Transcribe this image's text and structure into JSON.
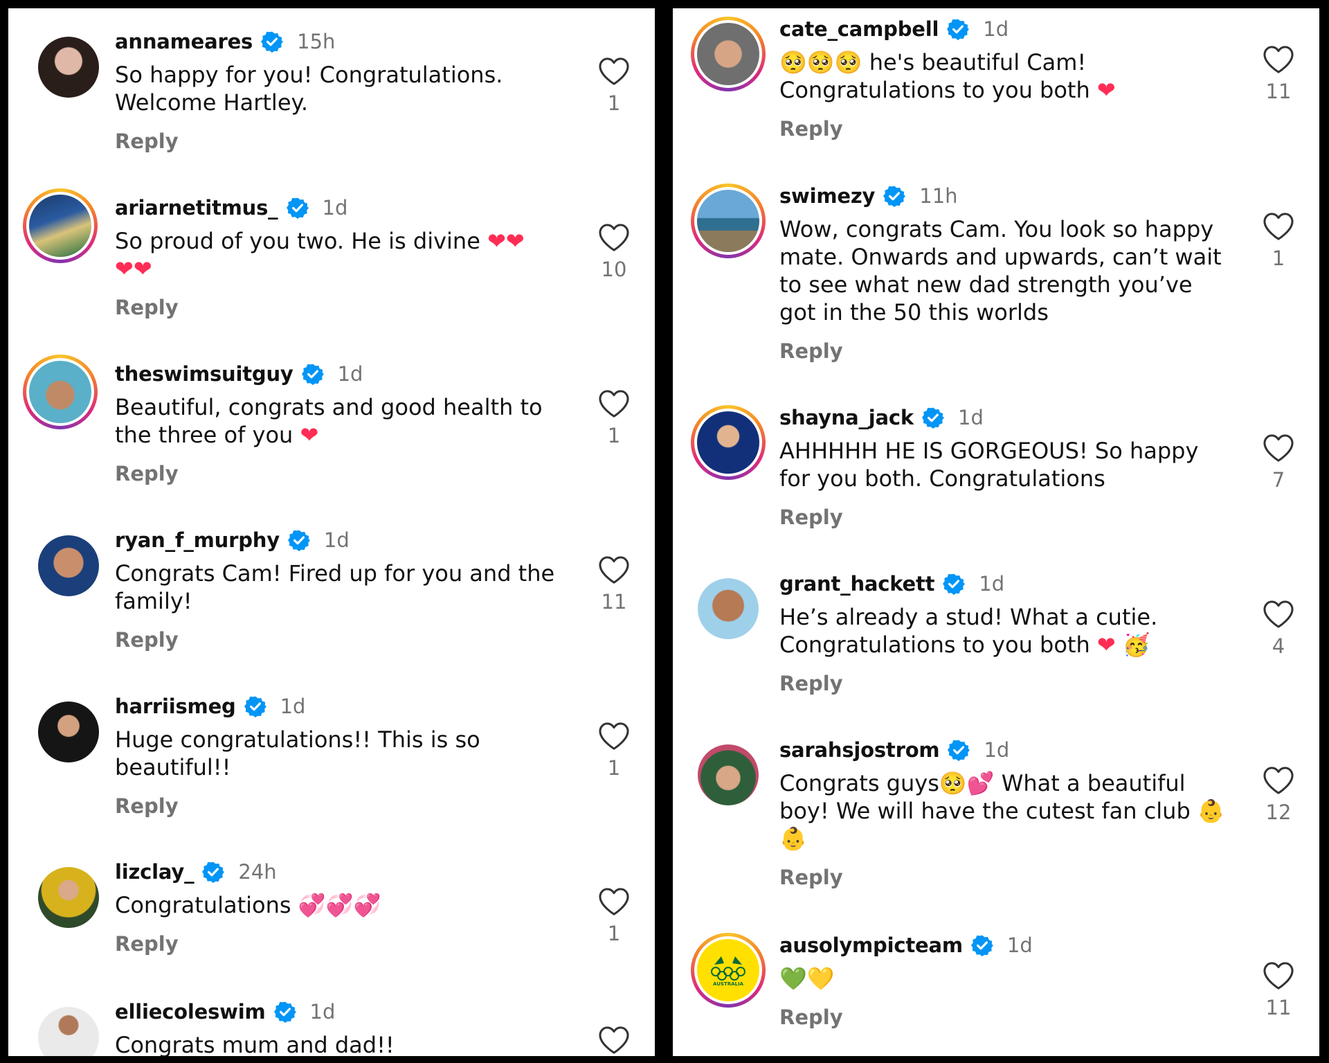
{
  "left_panel": {
    "comments": [
      {
        "username": "annameares",
        "time": "15h",
        "text": "So happy for you! Congratulations.\nWelcome Hartley.",
        "reply": "Reply",
        "likes": "1",
        "story_ring": false
      },
      {
        "username": "ariarnetitmus_",
        "time": "1d",
        "text": "So proud of you two. He is divine ❤❤\n❤❤",
        "reply": "Reply",
        "likes": "10",
        "story_ring": true
      },
      {
        "username": "theswimsuitguy",
        "time": "1d",
        "text": "Beautiful, congrats and good health to\nthe three of you ❤",
        "reply": "Reply",
        "likes": "1",
        "story_ring": true
      },
      {
        "username": "ryan_f_murphy",
        "time": "1d",
        "text": "Congrats Cam! Fired up for you and the\nfamily!",
        "reply": "Reply",
        "likes": "11",
        "story_ring": false
      },
      {
        "username": "harriismeg",
        "time": "1d",
        "text": "Huge congratulations!! This is so\nbeautiful!!",
        "reply": "Reply",
        "likes": "1",
        "story_ring": false
      },
      {
        "username": "lizclay_",
        "time": "24h",
        "text": "Congratulations 💞💞💞",
        "reply": "Reply",
        "likes": "1",
        "story_ring": false
      },
      {
        "username": "elliecoleswim",
        "time": "1d",
        "text": "Congrats mum and dad!!",
        "reply": "",
        "likes": "",
        "story_ring": false
      }
    ]
  },
  "right_panel": {
    "comments": [
      {
        "username": "cate_campbell",
        "time": "1d",
        "text": "🥺🥺🥺 he's beautiful Cam!\nCongratulations to you both ❤",
        "reply": "Reply",
        "likes": "11",
        "story_ring": true
      },
      {
        "username": "swimezy",
        "time": "11h",
        "text": "Wow, congrats Cam. You look so happy\nmate. Onwards and upwards, can’t wait\nto see what new dad strength you’ve\ngot in the 50 this worlds",
        "reply": "Reply",
        "likes": "1",
        "story_ring": true
      },
      {
        "username": "shayna_jack",
        "time": "1d",
        "text": "AHHHHH HE IS GORGEOUS! So happy\nfor you both. Congratulations",
        "reply": "Reply",
        "likes": "7",
        "story_ring": true
      },
      {
        "username": "grant_hackett",
        "time": "1d",
        "text": "He’s already a stud! What a cutie.\nCongratulations to you both ❤ 🥳",
        "reply": "Reply",
        "likes": "4",
        "story_ring": false
      },
      {
        "username": "sarahsjostrom",
        "time": "1d",
        "text": "Congrats guys🥺💕 What a beautiful\nboy! We will have the cutest fan club 👶\n👶",
        "reply": "Reply",
        "likes": "12",
        "story_ring": false
      },
      {
        "username": "ausolympicteam",
        "time": "1d",
        "text": "💚💛",
        "reply": "Reply",
        "likes": "11",
        "story_ring": true,
        "avatar_label": "AUSTRALIA"
      }
    ]
  },
  "colors": {
    "verified_blue": "#0095f6",
    "meta_gray": "#737373",
    "heart_red": "#ff2d55"
  },
  "icons": {
    "verified": "verified-badge-icon",
    "like": "heart-outline-icon"
  }
}
